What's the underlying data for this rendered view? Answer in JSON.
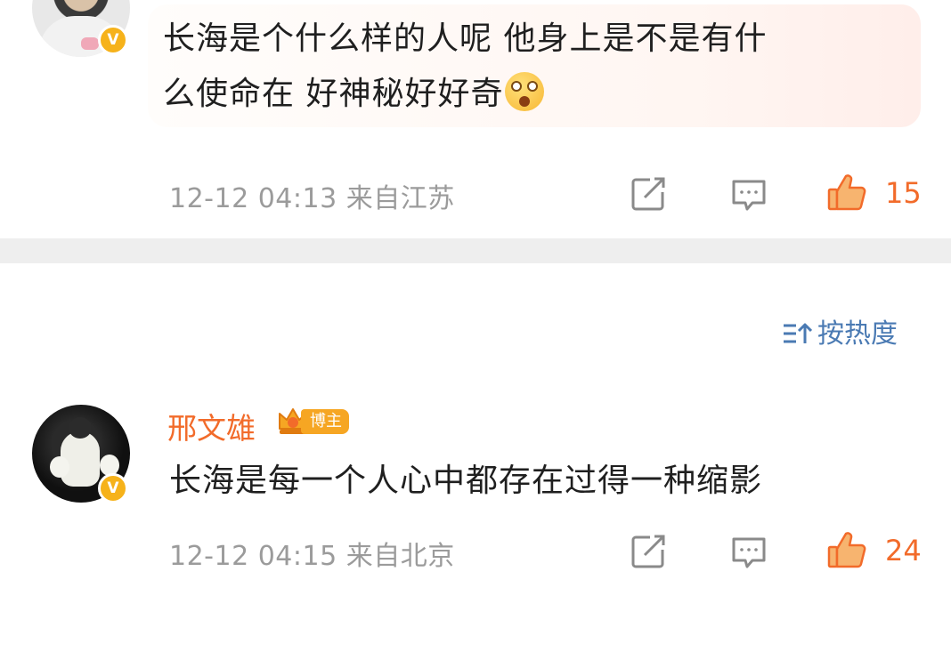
{
  "comments": [
    {
      "text_line1": "长海是个什么样的人呢 他身上是不是有什",
      "text_line2": "么使命在 好神秘好好奇",
      "emoji": "surprised-face-emoji",
      "time": "12-12 04:13",
      "location": "来自江苏",
      "likes": "15",
      "highlighted": true
    },
    {
      "username": "邢文雄",
      "badge": "博主",
      "text": "长海是每一个人心中都存在过得一种缩影",
      "time": "12-12 04:15",
      "location": "来自北京",
      "likes": "24"
    }
  ],
  "sort": {
    "label": "按热度",
    "icon": "sort-icon"
  },
  "verified_badge": "V",
  "icons": {
    "share": "share-icon",
    "reply": "comment-icon",
    "like": "thumbs-up-icon"
  },
  "colors": {
    "accent_orange": "#f26b2a",
    "link_blue": "#4a7ab3",
    "meta_gray": "#9b9b9b",
    "verified_gold": "#f6b21a"
  }
}
